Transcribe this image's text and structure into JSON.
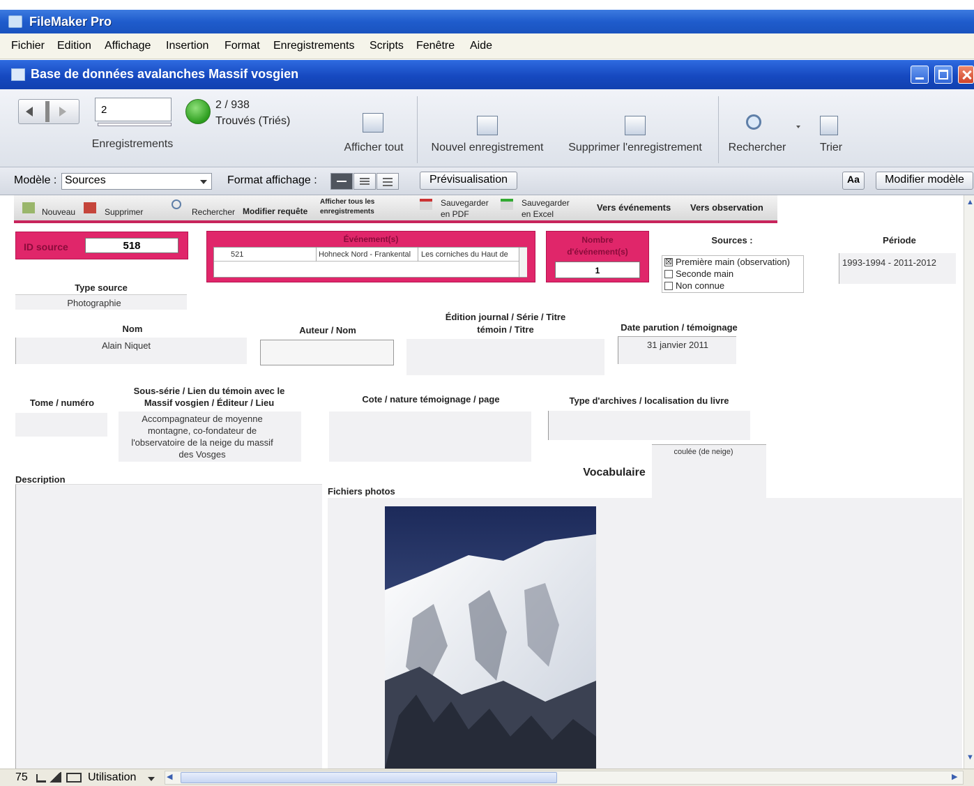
{
  "app": {
    "title": "FileMaker Pro"
  },
  "menu": [
    "Fichier",
    "Edition",
    "Affichage",
    "Insertion",
    "Format",
    "Enregistrements",
    "Scripts",
    "Fenêtre",
    "Aide"
  ],
  "window": {
    "title": "Base de données avalanches Massif vosgien"
  },
  "toolbar": {
    "record_value": "2",
    "records_label": "Enregistrements",
    "found_count": "2 / 938",
    "found_state": "Trouvés (Triés)",
    "show_all": "Afficher tout",
    "new_record": "Nouvel enregistrement",
    "delete_record": "Supprimer l'enregistrement",
    "search": "Rechercher",
    "sort": "Trier"
  },
  "layout_bar": {
    "model_label": "Modèle :",
    "model_value": "Sources",
    "view_label": "Format affichage :",
    "preview": "Prévisualisation",
    "aa": "Aa",
    "edit_layout": "Modifier modèle"
  },
  "nav": {
    "new": "Nouveau",
    "delete": "Supprimer",
    "search": "Rechercher",
    "modify_query": "Modifier requête",
    "show_all_line1": "Afficher tous les",
    "show_all_line2": "enregistrements",
    "save_pdf_line1": "Sauvegarder",
    "save_pdf_line2": "en PDF",
    "save_excel_line1": "Sauvegarder",
    "save_excel_line2": "en Excel",
    "to_events": "Vers événements",
    "to_observation": "Vers observation"
  },
  "form": {
    "id_source_label": "ID source",
    "id_source_value": "518",
    "events_label": "Événement(s)",
    "event_row": {
      "id": "521",
      "place": "Hohneck Nord - Frankental",
      "desc": "Les corniches du Haut de"
    },
    "count_label_line1": "Nombre",
    "count_label_line2": "d'événement(s)",
    "count_value": "1",
    "sources_label": "Sources :",
    "sources_options": [
      {
        "label": "Première main (observation)",
        "checked": true
      },
      {
        "label": "Seconde main",
        "checked": false
      },
      {
        "label": "Non connue",
        "checked": false
      }
    ],
    "periode_label": "Période",
    "periode_value": "1993-1994 - 2011-2012",
    "type_source_label": "Type source",
    "type_source_value": "Photographie",
    "nom_label": "Nom",
    "nom_value": "Alain Niquet",
    "auteur_label": "Auteur / Nom",
    "edition_label_line1": "Édition journal / Série / Titre",
    "edition_label_line2": "témoin / Titre",
    "date_label": "Date parution / témoignage",
    "date_value": "31 janvier 2011",
    "tome_label": "Tome / numéro",
    "sous_serie_label_line1": "Sous-série / Lien du témoin avec le",
    "sous_serie_label_line2": "Massif vosgien / Éditeur / Lieu",
    "sous_serie_value_lines": [
      "Accompagnateur de moyenne",
      "montagne, co-fondateur de",
      "l'observatoire de la neige du massif",
      "des Vosges"
    ],
    "cote_label": "Cote / nature  témoignage / page",
    "archives_label": "Type d'archives / localisation du livre",
    "vocab_value": "coulée (de neige)",
    "vocab_label": "Vocabulaire",
    "description_label": "Description",
    "photos_label": "Fichiers photos"
  },
  "status": {
    "zoom": "75",
    "mode": "Utilisation"
  },
  "colors": {
    "accent": "#e0266a",
    "title_bar": "#1f5ccc"
  }
}
